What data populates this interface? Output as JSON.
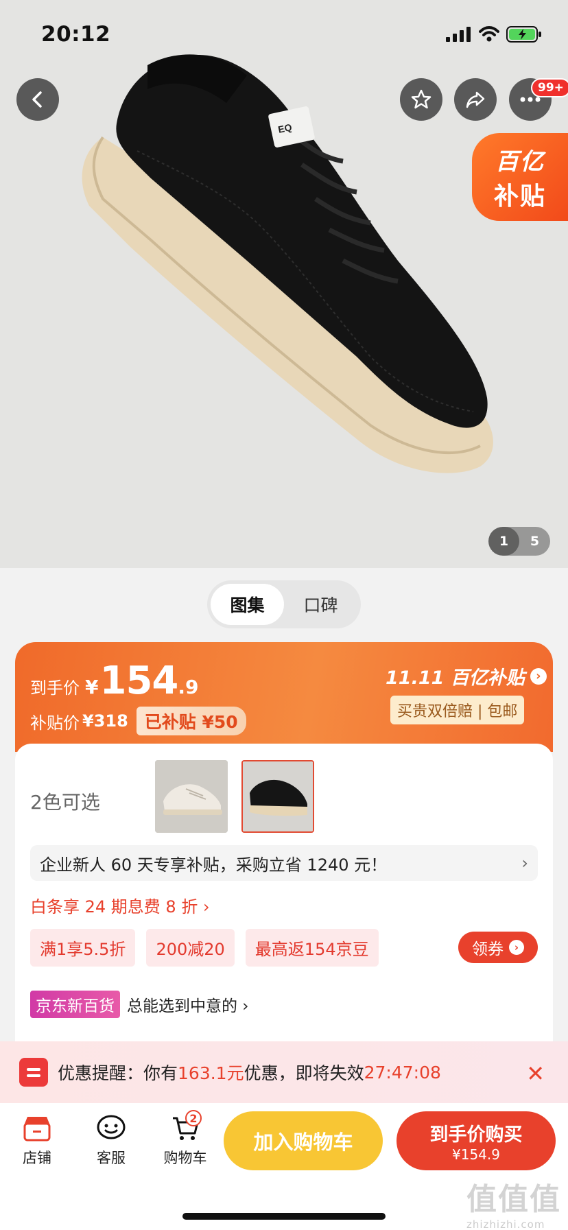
{
  "status_bar": {
    "time": "20:12"
  },
  "hero": {
    "more_badge": "99+",
    "subsidy_tag": {
      "line1": "百亿",
      "line2": "补贴"
    },
    "pager": {
      "current": "1",
      "total": "5"
    }
  },
  "tabs": [
    {
      "label": "图集",
      "active": true
    },
    {
      "label": "口碑",
      "active": false
    }
  ],
  "price": {
    "hand_price_label": "到手价",
    "currency": "¥",
    "integer": "154",
    "decimal": ".9",
    "subsidy_price_label": "补贴价",
    "subsidy_price": "¥318",
    "got_subsidy": "已补贴 ¥50",
    "brand_subsidy": "11.11 百亿补贴",
    "guarantee": "买贵双倍赔 | 包邮"
  },
  "colors": {
    "label": "2色可选",
    "options": [
      {
        "name": "white-sneaker"
      },
      {
        "name": "black-sneaker",
        "selected": true
      }
    ]
  },
  "enterprise": {
    "text": "企业新人 60 天专享补贴，采购立省 1240 元！",
    "arrow": "›"
  },
  "baitiao": {
    "text": "白条享 24 期息费 8 折 ›"
  },
  "coupons": [
    "满1享5.5折",
    "200减20",
    "最高返154京豆"
  ],
  "get_coupon": "领券",
  "jd_store": {
    "tag": "京东新百货",
    "text": "总能选到中意的 ›"
  },
  "promo": {
    "prefix": "优惠提醒：你有 ",
    "amount": "163.1元",
    "middle": "优惠，即将失效 ",
    "countdown": "27:47:08",
    "close": "✕"
  },
  "bottom_nav": {
    "store": "店铺",
    "service": "客服",
    "cart": "购物车",
    "cart_badge": "2",
    "add_to_cart": "加入购物车",
    "buy_title": "到手价购买",
    "buy_price": "¥154.9"
  },
  "watermark": {
    "main": "值值值",
    "sub": "zhizhizhi.com"
  },
  "colors_theme": {
    "accent": "#e8412c",
    "banner": "#f06a2a",
    "cart_btn": "#f8c634"
  }
}
